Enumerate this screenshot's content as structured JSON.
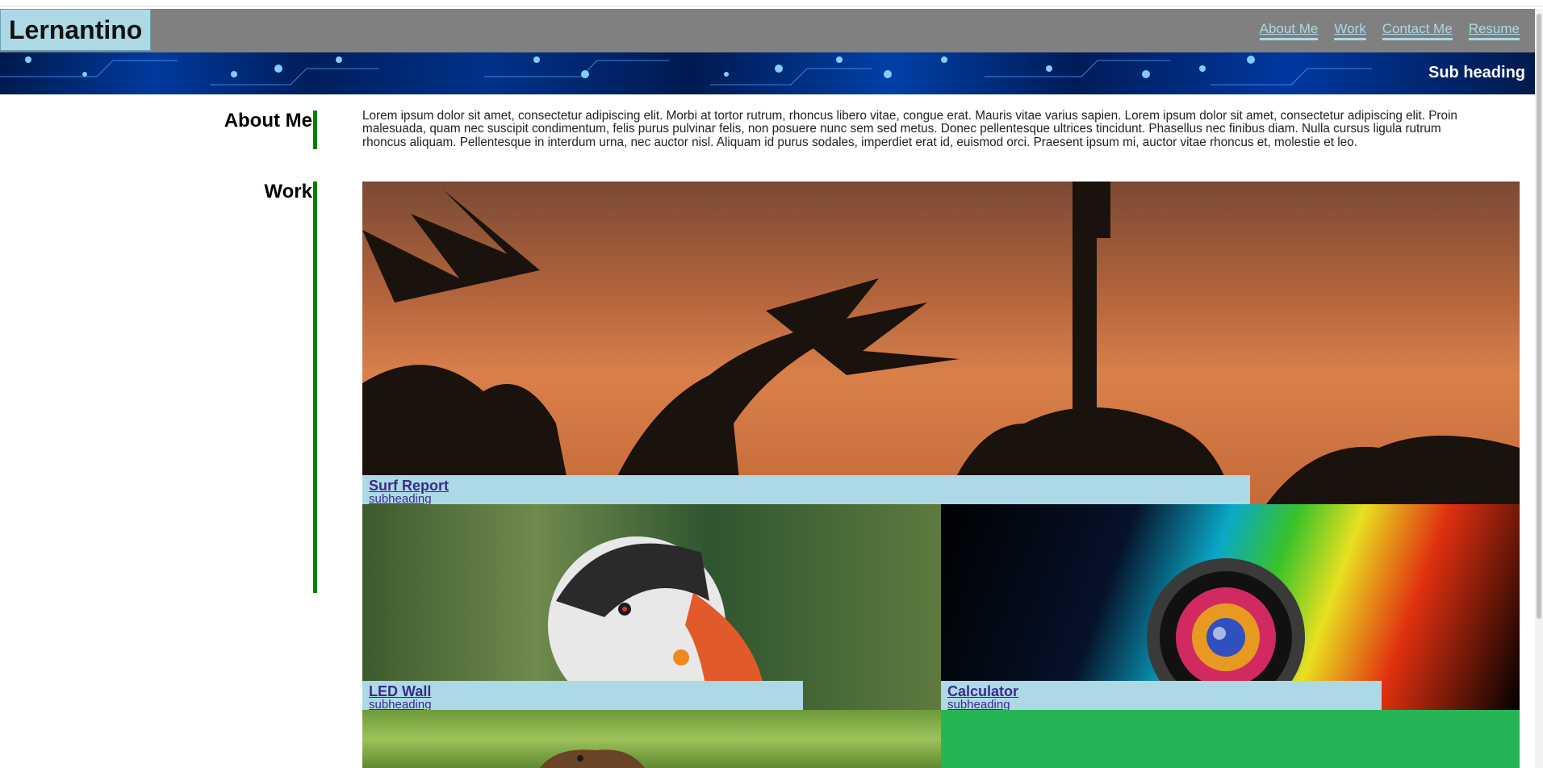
{
  "site": {
    "brand": "Lernantino",
    "nav": [
      "About Me",
      "Work",
      "Contact Me",
      "Resume"
    ]
  },
  "banner": {
    "heading": "Sub heading"
  },
  "about": {
    "title": "About Me",
    "text": "Lorem ipsum dolor sit amet, consectetur adipiscing elit. Morbi at tortor rutrum, rhoncus libero vitae, congue erat. Mauris vitae varius sapien. Lorem ipsum dolor sit amet, consectetur adipiscing elit. Proin malesuada, quam nec suscipit condimentum, felis purus pulvinar felis, non posuere nunc sem sed metus. Donec pellentesque ultrices tincidunt. Phasellus nec finibus diam. Nulla cursus ligula rutrum rhoncus aliquam. Pellentesque in interdum urna, nec auctor nisl. Aliquam id purus sodales, imperdiet erat id, euismod orci. Praesent ipsum mi, auctor vitae rhoncus et, molestie et leo."
  },
  "work": {
    "title": "Work",
    "projects": [
      {
        "title": "Surf Report",
        "subheading": "subheading"
      },
      {
        "title": "LED Wall",
        "subheading": "subheading"
      },
      {
        "title": "Calculator",
        "subheading": "subheading"
      }
    ]
  },
  "colors": {
    "header": "#808080",
    "accent": "#add8e6",
    "sidebar_line": "#008000",
    "tile_green": "#27b454"
  }
}
